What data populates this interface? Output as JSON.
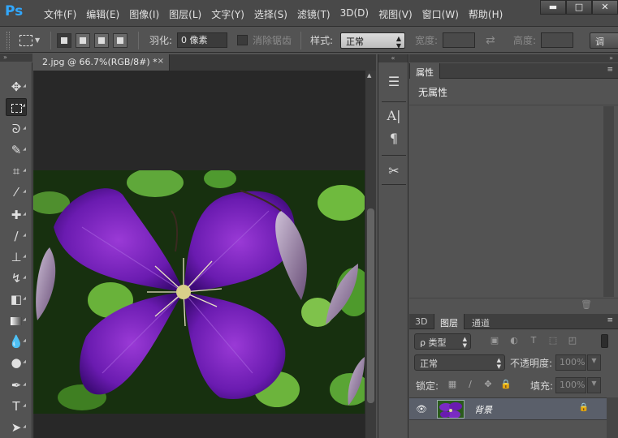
{
  "app": {
    "logo": "Ps",
    "menu": [
      "文件(F)",
      "编辑(E)",
      "图像(I)",
      "图层(L)",
      "文字(Y)",
      "选择(S)",
      "滤镜(T)",
      "3D(D)",
      "视图(V)",
      "窗口(W)",
      "帮助(H)"
    ],
    "window_controls": {
      "minimize": "▬",
      "maximize": "□",
      "close": "✕"
    }
  },
  "options": {
    "feather_label": "羽化:",
    "feather_value": "0 像素",
    "antialias_label": "消除锯齿",
    "style_label": "样式:",
    "style_value": "正常",
    "width_label": "宽度:",
    "swap_icon": "⇄",
    "height_label": "高度:",
    "refine_label": "调"
  },
  "document": {
    "tab_title": "2.jpg @ 66.7%(RGB/8#) *",
    "tab_close": "×"
  },
  "panels": {
    "collapse_left": "»",
    "collapse_mid": "«",
    "collapse_right": "»",
    "properties_tab": "属性",
    "properties_menu": "≡",
    "no_properties": "无属性",
    "layers_tabs": [
      "3D",
      "图层",
      "通道"
    ],
    "layers_menu": "≡",
    "kind_filter": "ρ 类型",
    "blend_mode": "正常",
    "opacity_label": "不透明度:",
    "opacity_value": "100%",
    "lock_label": "锁定:",
    "fill_label": "填充:",
    "fill_value": "100%",
    "layer_name": "背景",
    "trash_icon": "🗑"
  },
  "mid_panel_icons": [
    "paragraph-styles",
    "character",
    "paragraph",
    "tools-settings"
  ],
  "colors": {
    "accent_logo": "#31a8ff",
    "menubar_bg": "#494949",
    "panel_bg": "#535353",
    "canvas_bg": "#282828",
    "selected_layer": "#5a5f6a"
  }
}
